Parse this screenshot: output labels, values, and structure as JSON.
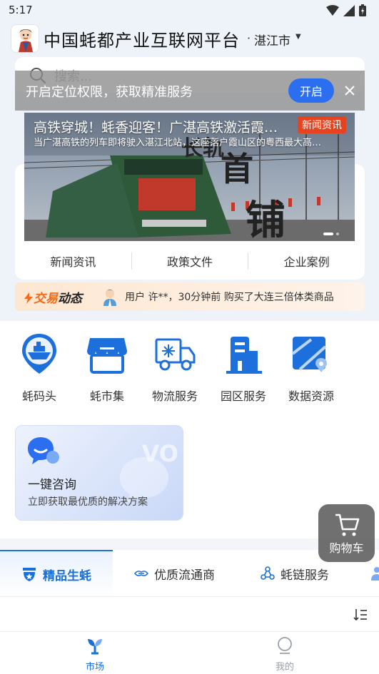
{
  "status_bar": {
    "time": "5:17"
  },
  "header": {
    "title": "中国蚝都产业互联网平台",
    "city_separator": "·",
    "city": "湛江市"
  },
  "search": {
    "placeholder": "搜索..."
  },
  "location_banner": {
    "message": "开启定位权限，获取精准服务",
    "open_label": "开启"
  },
  "banner": {
    "headline": "高铁穿城！蚝香迎客！广湛高铁激活霞…",
    "description": "当广湛高铁的列车即将驶入湛江北站，这座落户霞山区的粤西最大高…",
    "badge": "新闻资讯",
    "slide_count": 2,
    "active_slide": 1
  },
  "news_tabs": [
    {
      "label": "新闻资讯"
    },
    {
      "label": "政策文件"
    },
    {
      "label": "企业案例"
    }
  ],
  "trade_feed": {
    "logo_part1": "交易",
    "logo_part2": "动态",
    "message": "用户 许**，30分钟前 购买了大连三倍体类商品"
  },
  "services": [
    {
      "label": "蚝码头",
      "icon": "ship-pin-icon"
    },
    {
      "label": "蚝市集",
      "icon": "market-stall-icon"
    },
    {
      "label": "物流服务",
      "icon": "cold-chain-truck-icon"
    },
    {
      "label": "园区服务",
      "icon": "building-icon"
    },
    {
      "label": "数据资源",
      "icon": "map-data-icon"
    }
  ],
  "consult": {
    "title": "一键咨询",
    "subtitle": "立即获取最优质的解决方案"
  },
  "cart": {
    "label": "购物车"
  },
  "category_tabs": [
    {
      "label": "精品生蚝",
      "icon": "star-shield-icon",
      "active": true
    },
    {
      "label": "优质流通商",
      "icon": "handshake-icon",
      "active": false
    },
    {
      "label": "蚝链服务",
      "icon": "network-icon",
      "active": false
    }
  ],
  "bottom_nav": [
    {
      "label": "市场",
      "icon": "market-sprout-icon",
      "active": true,
      "color": "#1a6fd8"
    },
    {
      "label": "我的",
      "icon": "profile-icon",
      "active": false,
      "color": "#9aa0a8"
    }
  ],
  "colors": {
    "accent": "#1a6fd8",
    "button_blue": "#2b6ff0",
    "badge_red": "#e8431f",
    "trade_orange": "#f46a1a"
  }
}
